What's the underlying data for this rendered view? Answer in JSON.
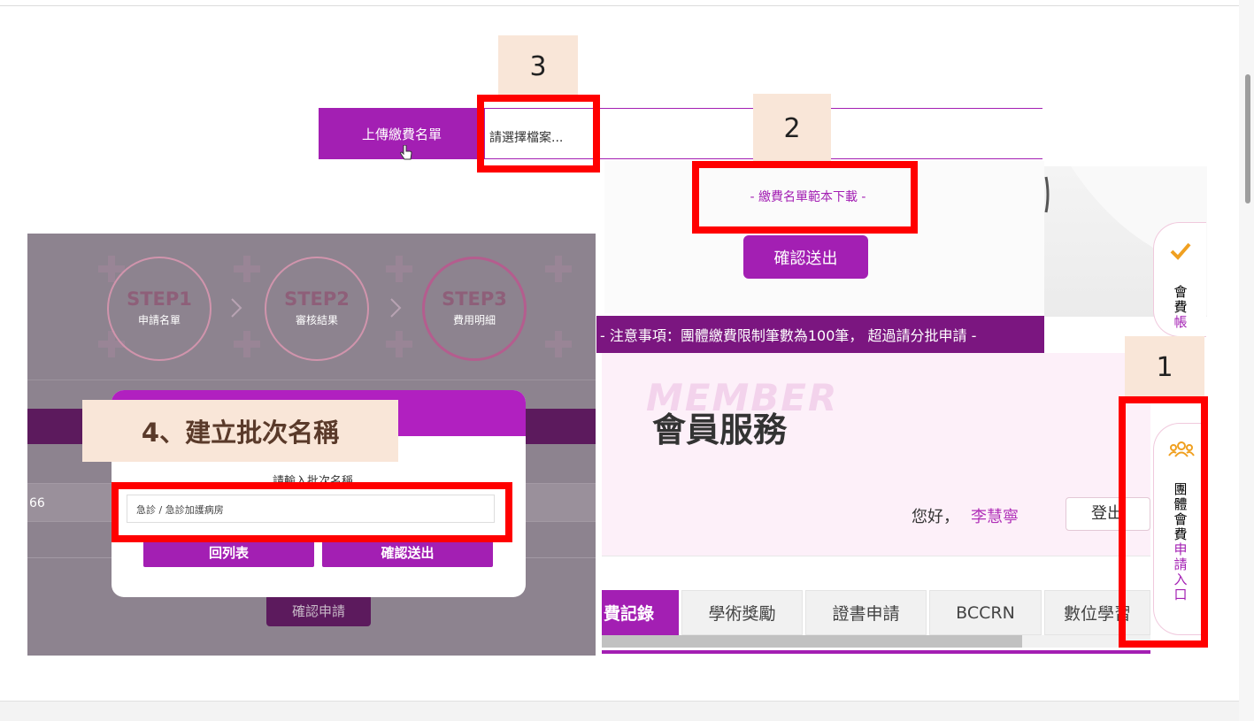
{
  "callouts": {
    "c1": "1",
    "c2": "2",
    "c3": "3",
    "c4": "4、建立批次名稱"
  },
  "upload": {
    "label": "上傳繳費名單",
    "file_placeholder": "請選擇檔案..."
  },
  "template_link": "- 繳費名單範本下載 -",
  "confirm_submit": "確認送出",
  "notice": "- 注意事項：團體繳費限制筆數為100筆， 超過請分批申請 -",
  "member": {
    "watermark": "MEMBER",
    "title": "會員服務",
    "greeting": "您好，",
    "user": "李慧寧",
    "logout": "登出"
  },
  "tabs": [
    "費記錄",
    "學術獎勵",
    "證書申請",
    "BCCRN",
    "數位學習"
  ],
  "side": {
    "fee_chars": [
      "會",
      "費",
      "帳"
    ],
    "group_chars": [
      "團",
      "體",
      "會",
      "費"
    ],
    "apply_chars": [
      "申",
      "請",
      "入",
      "口"
    ]
  },
  "steps": [
    {
      "t": "STEP1",
      "s": "申請名單"
    },
    {
      "t": "STEP2",
      "s": "審核結果"
    },
    {
      "t": "STEP3",
      "s": "費用明細"
    }
  ],
  "modal": {
    "prompt": "請輸入批次名稱",
    "input_value": "急診 / 急診加護病房",
    "back": "回列表",
    "submit": "確認送出"
  },
  "partial_row_text": "66",
  "apply_button": "確認申請",
  "colors": {
    "purple": "#a31fb3",
    "dark_purple": "#7b1680",
    "callout_red": "#ff0000",
    "callout_bg": "#f9e6d8"
  }
}
